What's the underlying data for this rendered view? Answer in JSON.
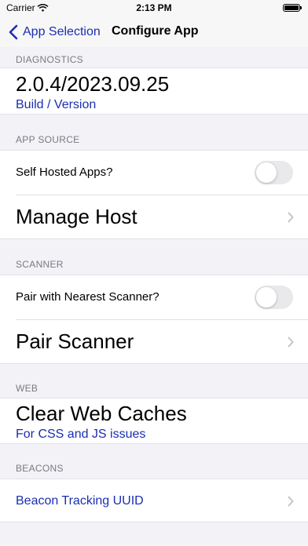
{
  "status_bar": {
    "carrier": "Carrier",
    "time": "2:13 PM"
  },
  "nav": {
    "back_label": "App Selection",
    "title": "Configure App"
  },
  "sections": {
    "diagnostics": {
      "header": "DIAGNOSTICS",
      "version": "2.0.4/2023.09.25",
      "version_caption": "Build / Version"
    },
    "app_source": {
      "header": "APP SOURCE",
      "self_hosted_label": "Self Hosted Apps?",
      "self_hosted_enabled": false,
      "manage_host_label": "Manage Host"
    },
    "scanner": {
      "header": "SCANNER",
      "pair_nearest_label": "Pair with Nearest Scanner?",
      "pair_nearest_enabled": false,
      "pair_scanner_label": "Pair Scanner"
    },
    "web": {
      "header": "WEB",
      "clear_caches_label": "Clear Web Caches",
      "clear_caches_caption": "For CSS and JS issues"
    },
    "beacons": {
      "header": "BEACONS",
      "uuid_label": "Beacon Tracking UUID"
    }
  },
  "colors": {
    "accent": "#1a2fb0",
    "background": "#f2f2f7",
    "separator": "#e2e2e6"
  }
}
